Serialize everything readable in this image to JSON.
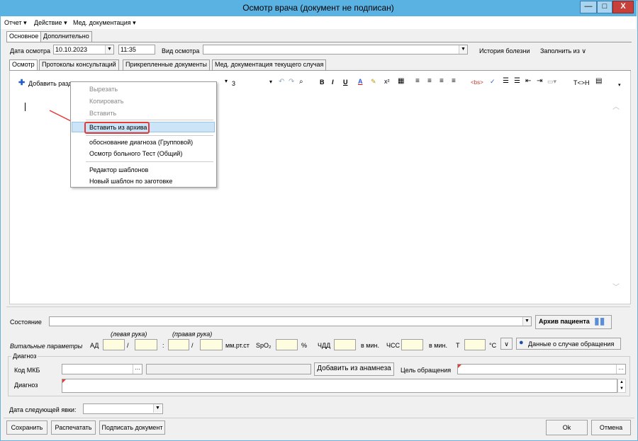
{
  "window": {
    "title": "Осмотр врача (документ не подписан)",
    "min": "—",
    "max": "□",
    "close": "X"
  },
  "menu": {
    "items": [
      "Отчет ▾",
      "Действие ▾",
      "Мед. документация ▾"
    ]
  },
  "top_tabs": [
    "Основное",
    "Дополнительно"
  ],
  "header": {
    "date_label": "Дата осмотра",
    "date_value": "10.10.2023",
    "time_value": "11:35",
    "kind_label": "Вид осмотра",
    "history_link": "История болезни",
    "fill_from": "Заполнить из  ∨"
  },
  "sub_tabs": [
    "Осмотр",
    "Протоколы консультаций",
    "Прикрепленные документы",
    "Мед. документация текущего случая"
  ],
  "toolbar": {
    "add_section": "Добавить разд",
    "font_size": "3",
    "tag_label": "<bs>",
    "th_label": "T<>H"
  },
  "context_menu": {
    "items_disabled": [
      "Вырезать",
      "Копировать",
      "Вставить"
    ],
    "highlighted": "Вставить из архива",
    "templates": [
      "обоснование диагноза (Групповой)",
      "Осмотр больного Тест (Общий)"
    ],
    "editors": [
      "Редактор шаблонов",
      "Новый шаблон по заготовке"
    ]
  },
  "state": {
    "label": "Состояние",
    "archive_button": "Архив пациента"
  },
  "vitals": {
    "label": "Витальные параметры",
    "left_arm": "(левая рука)",
    "right_arm": "(правая рука)",
    "ad": "АД",
    "slash": "/",
    "colon": ":",
    "mmhg": "мм.рт.ст",
    "spo2": "SpO₂",
    "percent": "%",
    "chdd": "ЧДД",
    "per_min": "в мин.",
    "chss": "ЧСС",
    "per_min2": "в мин.",
    "t": "Т",
    "celsius": "°С",
    "case_data": "Данные о случае обращения"
  },
  "diagnosis": {
    "group": "Диагноз",
    "mkb_label": "Код МКБ",
    "anamnesis_button": "Добавить из анамнеза",
    "goal_label": "Цель обращения",
    "diag_label": "Диагноз"
  },
  "next_visit": {
    "label": "Дата следующей явки:"
  },
  "footer": {
    "save": "Сохранить",
    "print": "Распечатать",
    "sign": "Подписать документ",
    "ok": "Ok",
    "cancel": "Отмена"
  },
  "colors": {
    "titlebar": "#5ab2e3",
    "highlight": "#cce4f7",
    "annotation": "#e53935"
  }
}
